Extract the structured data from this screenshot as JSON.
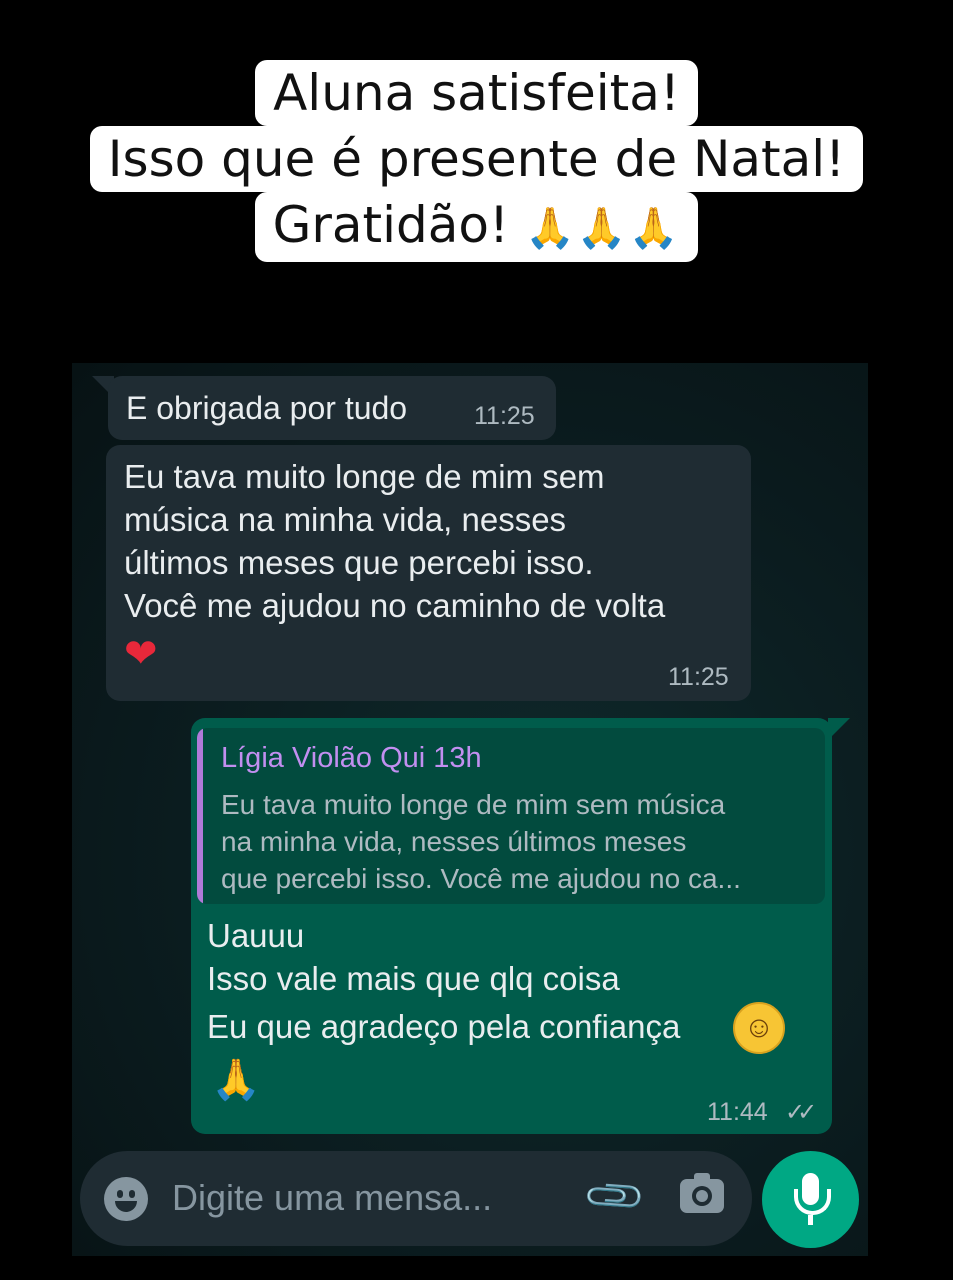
{
  "caption": {
    "line1": "Aluna satisfeita!",
    "line2": "Isso que é presente de Natal!",
    "line3": "Gratidão!",
    "line3_emoji": "🙏🙏🙏"
  },
  "messages": [
    {
      "direction": "incoming",
      "text": "E obrigada por tudo",
      "time": "11:25"
    },
    {
      "direction": "incoming",
      "lines": [
        "Eu tava muito longe de mim sem",
        "música na minha vida, nesses",
        "últimos meses que percebi isso.",
        "Você me ajudou no caminho de volta"
      ],
      "emoji": "❤",
      "time": "11:25"
    },
    {
      "direction": "outgoing",
      "quote": {
        "author": "Lígia Violão Qui 13h",
        "lines": [
          "Eu tava muito longe de mim sem música",
          "na minha vida, nesses últimos meses",
          "que percebi isso. Você me ajudou no ca..."
        ]
      },
      "lines": [
        "Uauuu",
        "Isso vale mais que qlq coisa",
        "Eu que agradeço pela confiança"
      ],
      "emoji_smile": "☺",
      "emoji_pray": "🙏",
      "time": "11:44",
      "status": "✓✓"
    }
  ],
  "composer": {
    "placeholder": "Digite uma mensa...",
    "emoji_icon": "emoji-icon",
    "attach_icon": "paperclip-icon",
    "camera_icon": "camera-icon",
    "mic_icon": "microphone-icon"
  },
  "colors": {
    "incoming_bubble": "#1f2c33",
    "outgoing_bubble": "#005c4b",
    "accent": "#00a884",
    "quote_author": "#c28ff0"
  }
}
